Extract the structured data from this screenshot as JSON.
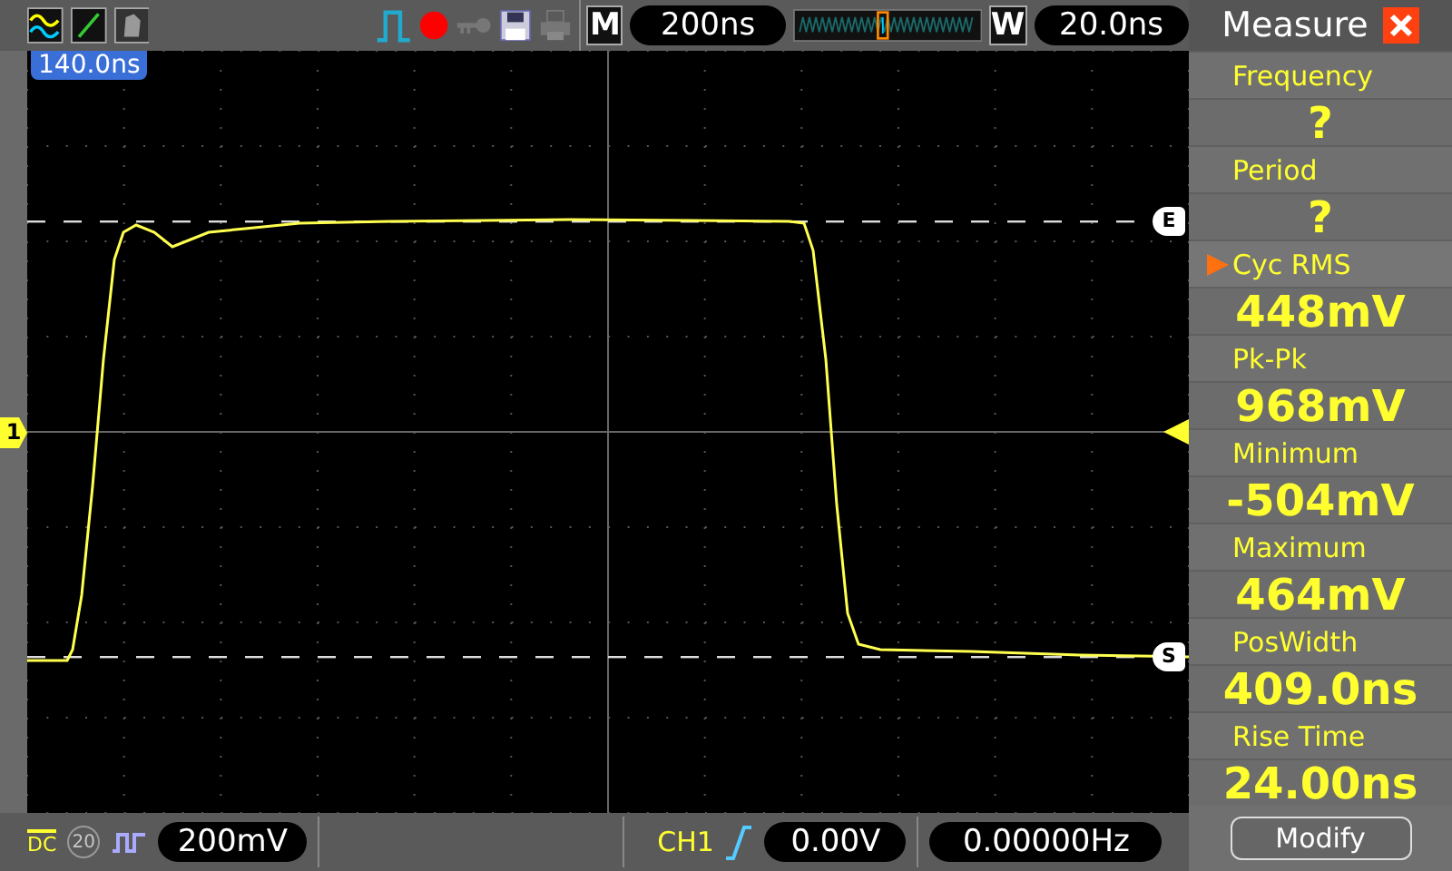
{
  "toolbar": {
    "m_label": "M",
    "timebase": "200ns",
    "w_label": "W",
    "window_delay": "20.0ns"
  },
  "plot": {
    "trigger_time": "140.0ns",
    "channel_marker": "1",
    "upper_cursor": "E",
    "lower_cursor": "S"
  },
  "measure": {
    "title": "Measure",
    "items": [
      {
        "label": "Frequency",
        "value": "?",
        "selected": false
      },
      {
        "label": "Period",
        "value": "?",
        "selected": false
      },
      {
        "label": "Cyc RMS",
        "value": "448mV",
        "selected": true
      },
      {
        "label": "Pk-Pk",
        "value": "968mV",
        "selected": false
      },
      {
        "label": "Minimum",
        "value": "-504mV",
        "selected": false
      },
      {
        "label": "Maximum",
        "value": "464mV",
        "selected": false
      },
      {
        "label": "PosWidth",
        "value": "409.0ns",
        "selected": false
      },
      {
        "label": "Rise Time",
        "value": "24.00ns",
        "selected": false
      }
    ],
    "modify_button": "Modify"
  },
  "status_bar": {
    "coupling": "DC",
    "bw_limit": {
      "label": "20",
      "on": false
    },
    "volts_per_div": "200mV",
    "trigger_source": "CH1",
    "trigger_level": "0.00V",
    "frequency": "0.00000Hz"
  }
}
